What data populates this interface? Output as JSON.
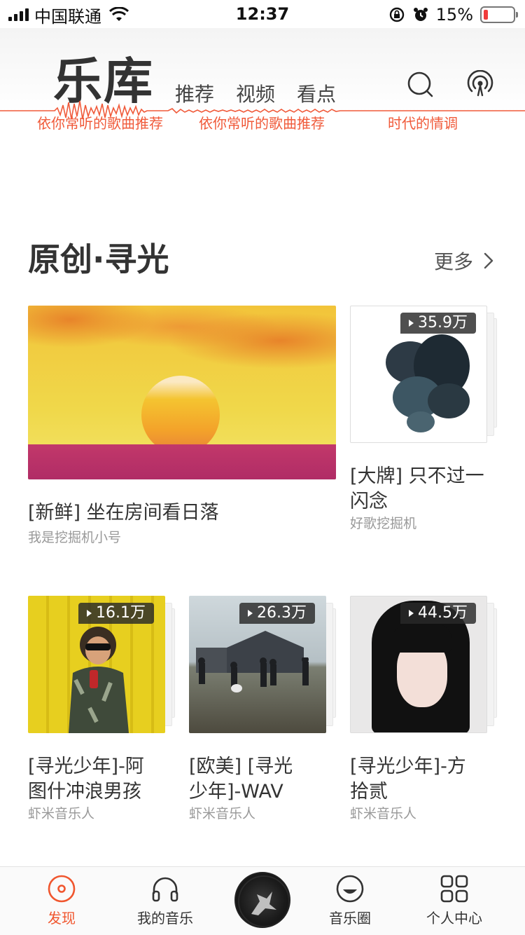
{
  "status_bar": {
    "carrier": "中国联通",
    "time": "12:37",
    "battery_percent": "15%",
    "battery_level": 0.15,
    "battery_color": "#f03c3c"
  },
  "header": {
    "title": "乐库",
    "tabs": [
      {
        "label": "推荐"
      },
      {
        "label": "视频"
      },
      {
        "label": "看点"
      }
    ],
    "captions": [
      "依你常听的歌曲推荐",
      "依你常听的歌曲推荐",
      "时代的情调"
    ],
    "accent_color": "#f05a3a",
    "icons": [
      "search-icon",
      "radio-broadcast-icon"
    ]
  },
  "section": {
    "title": "原创·寻光",
    "more_label": "更多"
  },
  "cards": [
    {
      "title": "[新鲜] 坐在房间看日落",
      "subtitle": "我是挖掘机小号"
    },
    {
      "count": "35.9万",
      "title_line1": "[大牌] 只不过一",
      "title_line2": "闪念",
      "subtitle": "好歌挖掘机"
    },
    {
      "count": "16.1万",
      "title_line1": "[寻光少年]-阿",
      "title_line2": "图什冲浪男孩",
      "subtitle": "虾米音乐人"
    },
    {
      "count": "26.3万",
      "title_line1": "[欧美] [寻光",
      "title_line2": "少年]-WAV",
      "subtitle": "虾米音乐人"
    },
    {
      "count": "44.5万",
      "title_line1": "[寻光少年]-方",
      "title_line2": "拾贰",
      "subtitle": "虾米音乐人"
    }
  ],
  "tabbar": {
    "items": [
      {
        "label": "发现",
        "icon": "disc-icon",
        "active": true
      },
      {
        "label": "我的音乐",
        "icon": "headphones-icon",
        "active": false
      },
      {
        "label": "音乐圈",
        "icon": "smile-icon",
        "active": false
      },
      {
        "label": "个人中心",
        "icon": "grid-icon",
        "active": false
      }
    ],
    "active_color": "#f0562e"
  }
}
